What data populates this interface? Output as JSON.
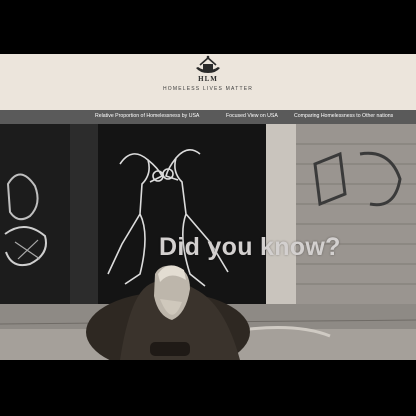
{
  "header": {
    "logo_icon": "hand-holding-house-icon",
    "logo_text": "HLM",
    "tagline": "HOMELESS LIVES MATTER"
  },
  "nav": {
    "items": [
      {
        "label": "Relative Proportion of Homelessness by USA"
      },
      {
        "label": "Focused View on USA"
      },
      {
        "label": "Comparing Homelessness to Other nations"
      }
    ]
  },
  "hero": {
    "heading": "Did you know?"
  },
  "colors": {
    "header_bg": "#ece5dc",
    "nav_bg": "#5a5a5a",
    "heading_text": "#d3d0cf"
  }
}
